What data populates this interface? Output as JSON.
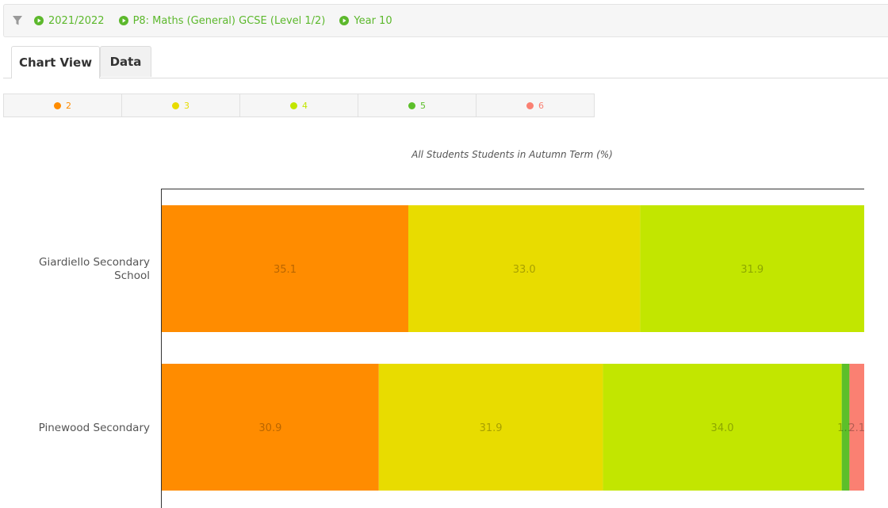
{
  "filters": [
    {
      "label": "2021/2022",
      "icon": "play-circle-icon"
    },
    {
      "label": "P8: Maths (General) GCSE (Level 1/2)",
      "icon": "play-circle-icon"
    },
    {
      "label": "Year 10",
      "icon": "play-circle-icon"
    }
  ],
  "tabs": {
    "chart_view": "Chart View",
    "data": "Data",
    "active": "Chart View"
  },
  "colors": {
    "2": "#ff8c00",
    "3": "#e8dc00",
    "4": "#c2e600",
    "5": "#5cbf2a",
    "6": "#fa8072"
  },
  "legend": [
    {
      "label": "2",
      "color": "#ff8c00"
    },
    {
      "label": "3",
      "color": "#e8dc00"
    },
    {
      "label": "4",
      "color": "#c2e600"
    },
    {
      "label": "5",
      "color": "#5cbf2a"
    },
    {
      "label": "6",
      "color": "#fa8072"
    }
  ],
  "chart_data": {
    "type": "bar",
    "orientation": "horizontal",
    "stacked": true,
    "title": "All Students Students in Autumn Term (%)",
    "categories": [
      "Giardiello Secondary School",
      "Pinewood Secondary"
    ],
    "category_lines": [
      [
        "Giardiello Secondary",
        "School"
      ],
      [
        "Pinewood Secondary"
      ]
    ],
    "series": [
      {
        "name": "2",
        "color": "#ff8c00",
        "values": [
          35.1,
          30.9
        ]
      },
      {
        "name": "3",
        "color": "#e8dc00",
        "values": [
          33.0,
          31.9
        ]
      },
      {
        "name": "4",
        "color": "#c2e600",
        "values": [
          31.9,
          34.0
        ]
      },
      {
        "name": "5",
        "color": "#5cbf2a",
        "values": [
          0,
          1.1
        ]
      },
      {
        "name": "6",
        "color": "#fa8072",
        "values": [
          0,
          2.1
        ]
      }
    ],
    "value_labels": [
      [
        "35.1",
        "33.0",
        "31.9",
        "",
        ""
      ],
      [
        "30.9",
        "31.9",
        "34.0",
        "1.1",
        "2.1"
      ]
    ],
    "xlim": [
      0,
      100
    ],
    "grid": false,
    "legend_position": "top-left"
  }
}
